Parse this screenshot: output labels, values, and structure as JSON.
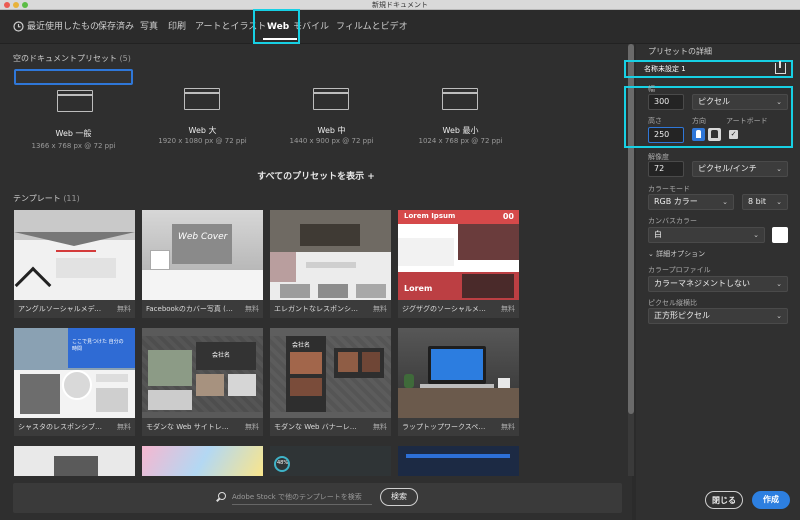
{
  "window": {
    "title": "新規ドキュメント"
  },
  "tabs": [
    "最近使用したもの",
    "保存済み",
    "写真",
    "印刷",
    "アートとイラスト",
    "Web",
    "モバイル",
    "フィルムとビデオ"
  ],
  "blank_presets": {
    "title": "空のドキュメントプリセット",
    "count": "(5)",
    "items": [
      {
        "name": "Web 一般",
        "size": "1366 x 768 px @ 72 ppi",
        "selected": true
      },
      {
        "name": "Web 大",
        "size": "1920 x 1080 px @ 72 ppi",
        "selected": false
      },
      {
        "name": "Web 中",
        "size": "1440 x 900 px @ 72 ppi",
        "selected": false
      },
      {
        "name": "Web 最小",
        "size": "1024 x 768 px @ 72 ppi",
        "selected": false
      }
    ],
    "show_all": "すべてのプリセットを表示 +"
  },
  "templates": {
    "title": "テンプレート",
    "count": "(11)",
    "free_label": "無料",
    "items": [
      {
        "name": "アングルソーシャルメディア..."
      },
      {
        "name": "Facebookのカバー写真 (手描..."
      },
      {
        "name": "エレガントなレスポンシブペ..."
      },
      {
        "name": "ジグザグのソーシャルメディ..."
      },
      {
        "name": "シャスタのレスポンシブペー..."
      },
      {
        "name": "モダンな Web サイトレイアウト"
      },
      {
        "name": "モダンな Web バナーレイアウト"
      },
      {
        "name": "ラップトップワークスペース..."
      }
    ],
    "thumb_texts": {
      "t2": "Web Cover",
      "t4": "Lorem Ipsum",
      "t4b": "Lorem",
      "t4n": "00",
      "t5": "ここで見つけた 自分の時間",
      "t6": "会社名",
      "t7": "会社名",
      "t10": "48%"
    }
  },
  "search": {
    "placeholder": "Adobe Stock で他のテンプレートを検索",
    "button": "検索"
  },
  "details": {
    "title": "プリセットの詳細",
    "name_value": "名称未設定 1",
    "width_label": "幅",
    "width_value": "300",
    "unit": "ピクセル",
    "height_label": "高さ",
    "height_value": "250",
    "orientation_label": "方向",
    "artboard_label": "アートボード",
    "resolution_label": "解像度",
    "resolution_value": "72",
    "resolution_unit": "ピクセル/インチ",
    "color_mode_label": "カラーモード",
    "color_mode_value": "RGB カラー",
    "bit_depth": "8 bit",
    "canvas_label": "カンバスカラー",
    "canvas_value": "白",
    "advanced_label": "詳細オプション",
    "profile_label": "カラープロファイル",
    "profile_value": "カラーマネジメントしない",
    "aspect_label": "ピクセル縦横比",
    "aspect_value": "正方形ピクセル"
  },
  "buttons": {
    "close": "閉じる",
    "create": "作成"
  },
  "colors": {
    "highlight": "#17d0e4",
    "accent": "#2f77d8",
    "create_button": "#2d7fe0"
  }
}
